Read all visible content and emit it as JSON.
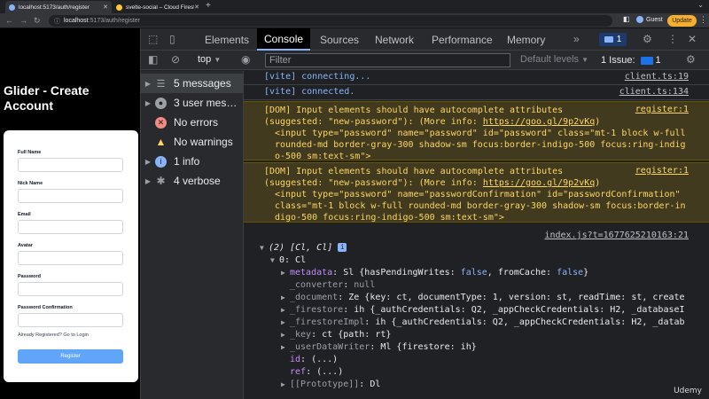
{
  "browser": {
    "tabs": [
      {
        "label": "localhost:5173/auth/register",
        "active": true
      },
      {
        "label": "svelte-social – Cloud Firestore",
        "active": false
      }
    ],
    "url_host": "localhost",
    "url_path": ":5173/auth/register",
    "profile": "Guest",
    "update_label": "Update"
  },
  "page": {
    "title": "Glider - Create Account",
    "form": {
      "fields": [
        {
          "label": "Full Name"
        },
        {
          "label": "Nick Name"
        },
        {
          "label": "Email"
        },
        {
          "label": "Avatar"
        },
        {
          "label": "Password"
        },
        {
          "label": "Password Confirmation"
        }
      ],
      "login_link": "Already Registered? Go to Login",
      "register_button": "Register"
    }
  },
  "devtools": {
    "tabs": [
      "Elements",
      "Console",
      "Sources",
      "Network",
      "Performance",
      "Memory"
    ],
    "active_tab": "Console",
    "messages_badge": "1",
    "toolbar": {
      "context": "top",
      "filter_placeholder": "Filter",
      "levels": "Default levels",
      "issues": "1 Issue:",
      "issues_count": "1"
    },
    "sidebar": [
      {
        "label": "5 messages",
        "icon": "list-icon",
        "color": "#9aa0a6"
      },
      {
        "label": "3 user mes…",
        "icon": "user-icon",
        "color": "#9aa0a6"
      },
      {
        "label": "No errors",
        "icon": "error-icon",
        "color": "#f28b82"
      },
      {
        "label": "No warnings",
        "icon": "warning-icon",
        "color": "#fdd663"
      },
      {
        "label": "1 info",
        "icon": "info-icon",
        "color": "#8ab4f8"
      },
      {
        "label": "4 verbose",
        "icon": "bug-icon",
        "color": "#9aa0a6"
      }
    ],
    "console": {
      "vite1": {
        "text": "[vite] connecting...",
        "src": "client.ts:19"
      },
      "vite2": {
        "text": "[vite] connected.",
        "src": "client.ts:134"
      },
      "warn1": {
        "l1": "[DOM] Input elements should have autocomplete attributes",
        "l2a": "(suggested: \"new-password\"): (More info: ",
        "link": "https://goo.gl/9p2vKq",
        "l2b": ")",
        "src": "register:1",
        "c1": "<input type=\"password\" name=\"password\" id=\"password\" class=\"mt-1 block w-full",
        "c2": "rounded-md border-gray-300 shadow-sm focus:border-indigo-500 focus:ring-indig",
        "c3": "o-500 sm:text-sm\">"
      },
      "warn2": {
        "l1": "[DOM] Input elements should have autocomplete attributes",
        "l2a": "(suggested: \"new-password\"): (More info: ",
        "link": "https://goo.gl/9p2vKq",
        "l2b": ")",
        "src": "register:1",
        "c1": "<input type=\"password\" name=\"passwordConfirmation\" id=\"passwordConfirmation\"",
        "c2": "class=\"mt-1 block w-full rounded-md border-gray-300 shadow-sm focus:border-in",
        "c3": "digo-500 focus:ring-indigo-500 sm:text-sm\">"
      },
      "obj_src": "index.js?t=1677625210163:21",
      "obj_head": "(2) [Cl, Cl]",
      "item0": "0: Cl",
      "props": {
        "metadata": {
          "key": "metadata",
          "val": "Sl {hasPendingWrites: ",
          "v1": "false",
          "mid": ", fromCache: ",
          "v2": "false",
          "end": "}"
        },
        "converter": {
          "key": "_converter",
          "val": "null"
        },
        "document": {
          "key": "_document",
          "val": "Ze {key: ct, documentType: 1, version: st, readTime: st, create"
        },
        "firestore": {
          "key": "_firestore",
          "val": "ih {_authCredentials: Q2, _appCheckCredentials: H2, _databaseI"
        },
        "firestoreImpl": {
          "key": "_firestoreImpl",
          "val": "ih {_authCredentials: Q2, _appCheckCredentials: H2, _datab"
        },
        "key": {
          "key": "_key",
          "val": "ct {path: rt}"
        },
        "userDataWriter": {
          "key": "_userDataWriter",
          "val": "Ml {firestore: ih}"
        },
        "id": {
          "key": "id",
          "val": "(...)"
        },
        "ref": {
          "key": "ref",
          "val": "(...)"
        },
        "proto": {
          "key": "[[Prototype]]",
          "val": "Dl"
        }
      }
    }
  },
  "watermark": "Udemy"
}
